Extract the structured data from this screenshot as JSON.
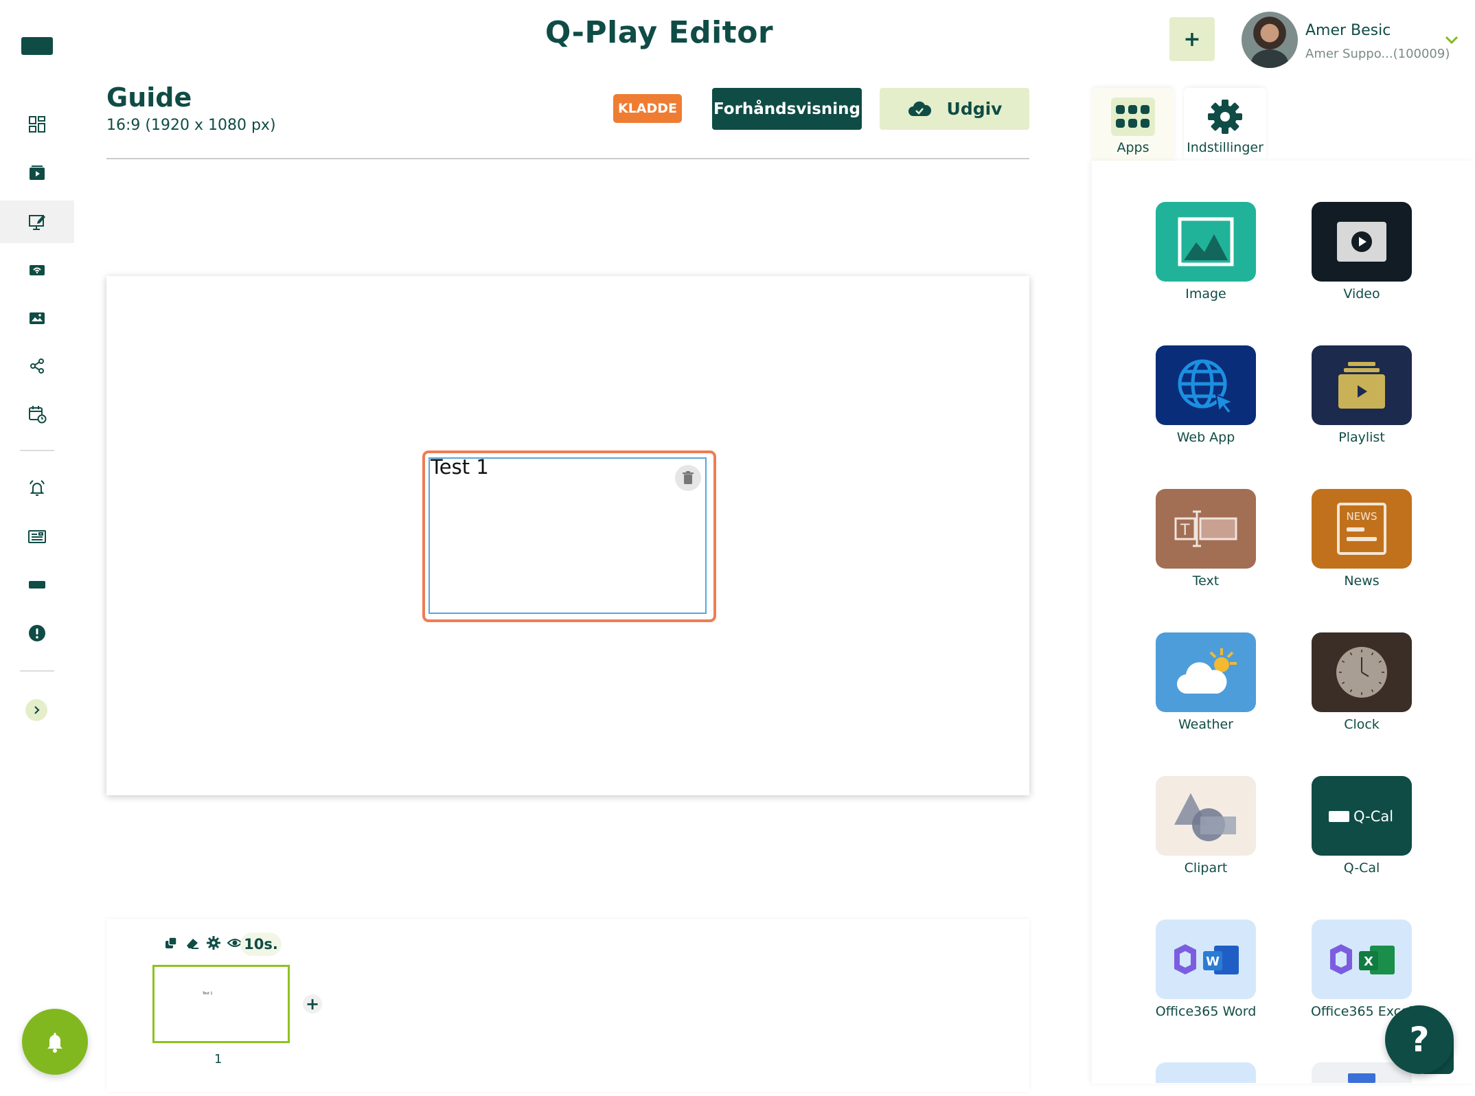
{
  "header": {
    "app_title": "Q-Play Editor",
    "add_label": "+",
    "user_name": "Amer Besic",
    "user_sub": "Amer Suppo...(100009)"
  },
  "guide": {
    "title": "Guide",
    "resolution": "16:9 (1920 x 1080 px)",
    "status_badge": "KLADDE",
    "preview_label": "Forhåndsvisning",
    "publish_label": "Udgiv"
  },
  "canvas": {
    "text_widget_content": "Test 1"
  },
  "timeline": {
    "duration": "10s.",
    "slide_number": "1",
    "thumb_text": "Test 1",
    "add_label": "+"
  },
  "panel": {
    "tabs": [
      {
        "label": "Apps",
        "icon": "apps-grid-icon"
      },
      {
        "label": "Indstillinger",
        "icon": "gear-icon"
      }
    ],
    "apps": [
      {
        "label": "Image",
        "color": "#21b39a"
      },
      {
        "label": "Video",
        "color": "#111c24"
      },
      {
        "label": "Web App",
        "color": "#0a2d7a"
      },
      {
        "label": "Playlist",
        "color": "#1c2a4d"
      },
      {
        "label": "Text",
        "color": "#a26e54"
      },
      {
        "label": "News",
        "color": "#c1711c"
      },
      {
        "label": "Weather",
        "color": "#4d9ddb"
      },
      {
        "label": "Clock",
        "color": "#3a2e27"
      },
      {
        "label": "Clipart",
        "color": "#f4ebe3"
      },
      {
        "label": "Q-Cal",
        "color": "#0f4c45"
      },
      {
        "label": "Office365 Word",
        "color": "#d5e8fb"
      },
      {
        "label": "Office365 Excel",
        "color": "#d5e8fb"
      }
    ],
    "qcal_tile_text": "Q-Cal",
    "news_tile_text": "NEWS"
  },
  "help": {
    "label": "?"
  },
  "colors": {
    "brand": "#0f4c45",
    "accent_light": "#e4eeca",
    "draft_orange": "#ee7d33",
    "lime": "#82b81f"
  }
}
